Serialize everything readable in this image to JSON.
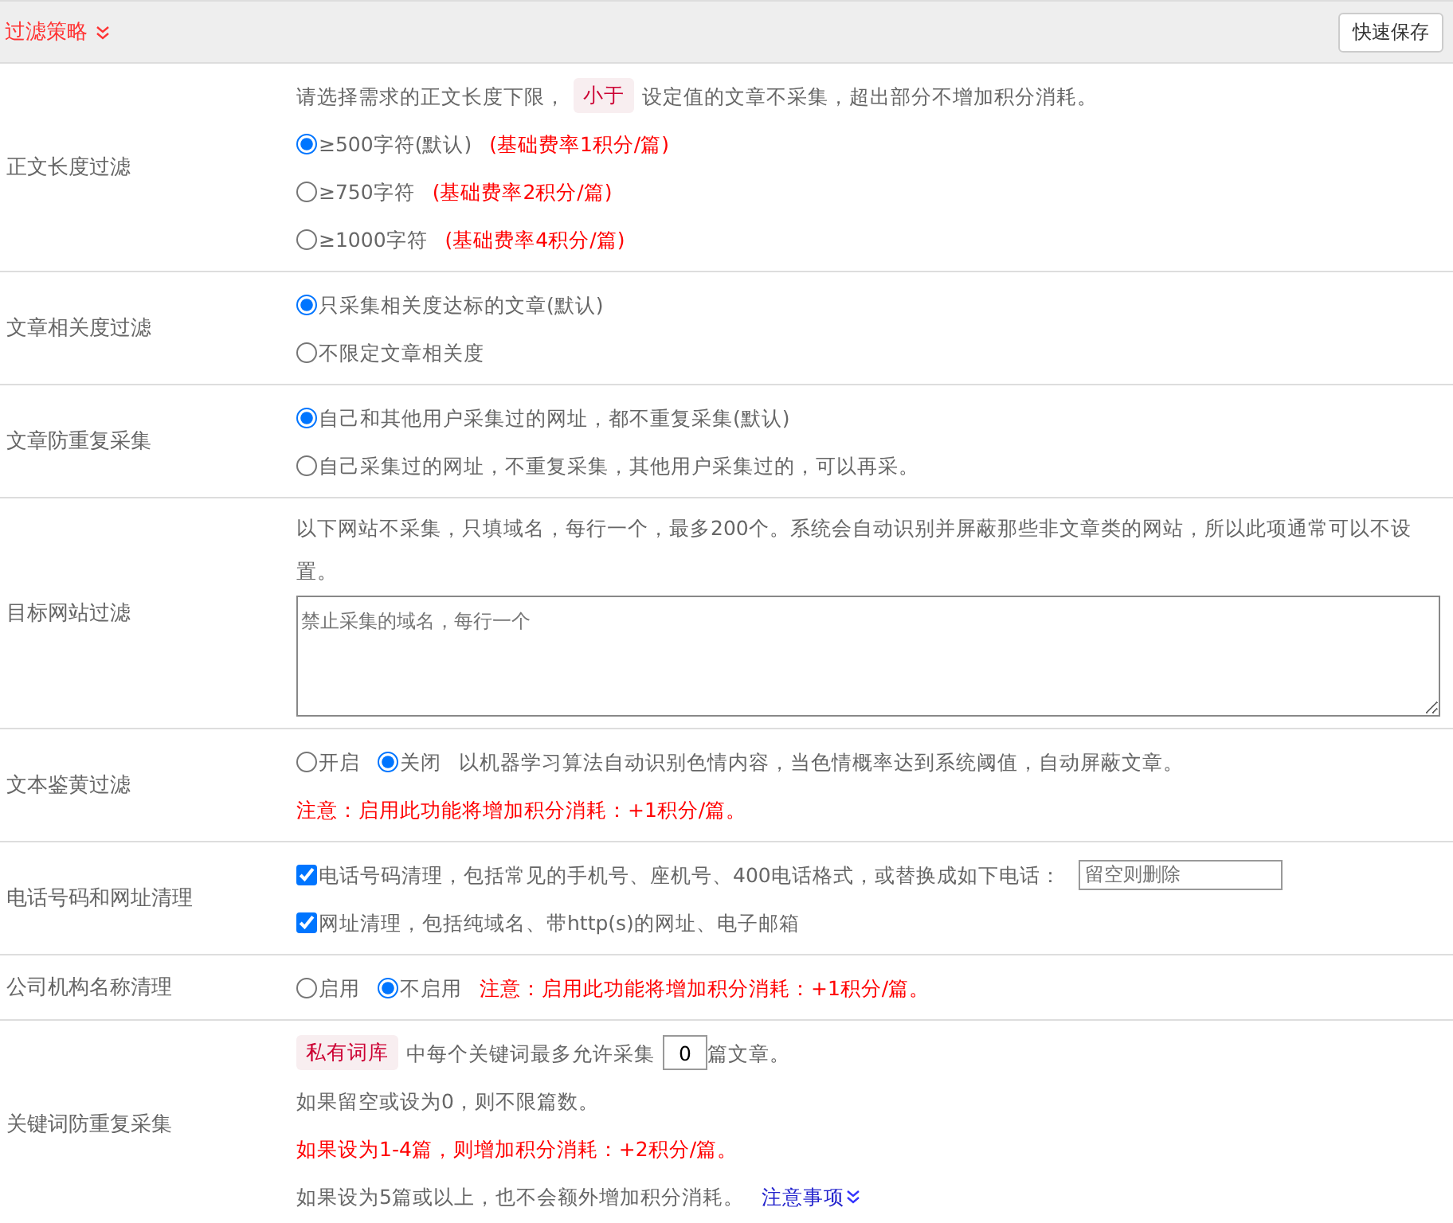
{
  "header": {
    "title": "过滤策略",
    "button": "快速保存"
  },
  "rows": [
    {
      "label": "正文长度过滤",
      "lines": [
        {
          "parts": [
            {
              "kind": "text",
              "text": "请选择需求的正文长度下限，"
            },
            {
              "kind": "tag",
              "text": "小于"
            },
            {
              "kind": "text",
              "text": "设定值的文章不采集，超出部分不增加积分消耗。"
            }
          ]
        },
        {
          "parts": [
            {
              "kind": "radio",
              "text": "≥500字符(默认)",
              "selected": true
            },
            {
              "kind": "note",
              "text": "(基础费率1积分/篇)"
            }
          ]
        },
        {
          "parts": [
            {
              "kind": "radio",
              "text": "≥750字符",
              "selected": false
            },
            {
              "kind": "note",
              "text": "(基础费率2积分/篇)"
            }
          ]
        },
        {
          "parts": [
            {
              "kind": "radio",
              "text": "≥1000字符",
              "selected": false
            },
            {
              "kind": "note",
              "text": "(基础费率4积分/篇)"
            }
          ]
        }
      ]
    },
    {
      "label": "文章相关度过滤",
      "lines": [
        {
          "parts": [
            {
              "kind": "radio",
              "text": "只采集相关度达标的文章(默认)",
              "selected": true
            }
          ]
        },
        {
          "parts": [
            {
              "kind": "radio",
              "text": "不限定文章相关度",
              "selected": false
            }
          ]
        }
      ]
    },
    {
      "label": "文章防重复采集",
      "lines": [
        {
          "parts": [
            {
              "kind": "radio",
              "text": "自己和其他用户采集过的网址，都不重复采集(默认)",
              "selected": true
            }
          ]
        },
        {
          "parts": [
            {
              "kind": "radio",
              "text": "自己采集过的网址，不重复采集，其他用户采集过的，可以再采。",
              "selected": false
            }
          ]
        }
      ]
    },
    {
      "label": "目标网站过滤",
      "lines": [
        {
          "parts": [
            {
              "kind": "text",
              "text": "以下网站不采集，只填域名，每行一个，最多200个。系统会自动识别并屏蔽那些非文章类的网站，所以此项通常可以不设置。"
            }
          ]
        },
        {
          "parts": [
            {
              "kind": "textarea",
              "placeholder": "禁止采集的域名，每行一个"
            }
          ]
        }
      ]
    },
    {
      "label": "文本鉴黄过滤",
      "lines": [
        {
          "parts": [
            {
              "kind": "radio",
              "text": "开启",
              "selected": false
            },
            {
              "kind": "radio",
              "text": "关闭",
              "selected": true
            },
            {
              "kind": "text",
              "text": "以机器学习算法自动识别色情内容，当色情概率达到系统阈值，自动屏蔽文章。"
            }
          ]
        },
        {
          "parts": [
            {
              "kind": "note",
              "text": "注意：启用此功能将增加积分消耗：+1积分/篇。"
            }
          ]
        }
      ]
    },
    {
      "label": "电话号码和网址清理",
      "lines": [
        {
          "parts": [
            {
              "kind": "checkbox",
              "text": "电话号码清理，包括常见的手机号、座机号、400电话格式，或替换成如下电话：",
              "checked": true
            },
            {
              "kind": "input",
              "placeholder": "留空则删除"
            }
          ]
        },
        {
          "parts": [
            {
              "kind": "checkbox",
              "text": "网址清理，包括纯域名、带http(s)的网址、电子邮箱",
              "checked": true
            }
          ]
        }
      ]
    },
    {
      "label": "公司机构名称清理",
      "lines": [
        {
          "parts": [
            {
              "kind": "radio",
              "text": "启用",
              "selected": false
            },
            {
              "kind": "radio",
              "text": "不启用",
              "selected": true
            },
            {
              "kind": "note",
              "text": "注意：启用此功能将增加积分消耗：+1积分/篇。"
            }
          ]
        }
      ]
    },
    {
      "label": "关键词防重复采集",
      "lines": [
        {
          "parts": [
            {
              "kind": "tag",
              "text": "私有词库"
            },
            {
              "kind": "text",
              "text": "中每个关键词最多允许采集"
            },
            {
              "kind": "number",
              "value": "0"
            },
            {
              "kind": "text",
              "text": "篇文章。"
            }
          ]
        },
        {
          "parts": [
            {
              "kind": "text",
              "text": "如果留空或设为0，则不限篇数。"
            }
          ]
        },
        {
          "parts": [
            {
              "kind": "note",
              "text": "如果设为1-4篇，则增加积分消耗：+2积分/篇。"
            }
          ]
        },
        {
          "parts": [
            {
              "kind": "text",
              "text": "如果设为5篇或以上，也不会额外增加积分消耗。"
            },
            {
              "kind": "link",
              "text": "注意事项"
            }
          ]
        }
      ]
    }
  ]
}
